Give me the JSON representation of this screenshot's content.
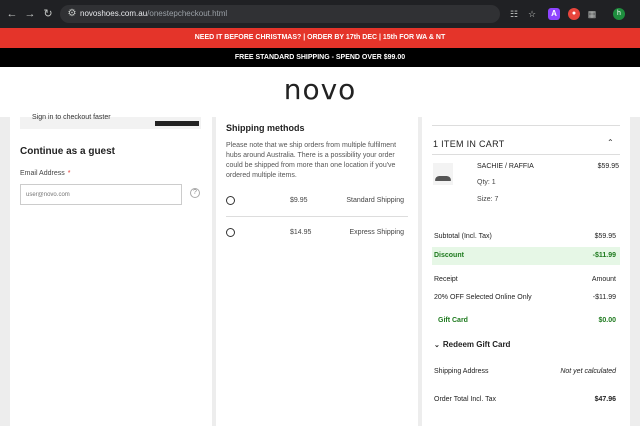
{
  "browser": {
    "url_host": "novoshoes.com.au",
    "url_path": "/onestepcheckout.html",
    "extension_a": "A",
    "profile_initial": "h"
  },
  "banners": {
    "promo": "NEED IT BEFORE CHRISTMAS? | ORDER BY 17th DEC | 15th FOR WA & NT",
    "shipping": "FREE STANDARD SHIPPING - SPEND OVER $99.00"
  },
  "header": {
    "logo": "novo"
  },
  "left": {
    "signin_text": "Sign in to checkout faster",
    "guest_title": "Continue as a guest",
    "email_label": "Email Address",
    "email_required": "*",
    "email_placeholder": "user@novo.com",
    "help_glyph": "?"
  },
  "shipping": {
    "title": "Shipping methods",
    "note": "Please note that we ship orders from multiple fulfilment hubs around Australia. There is a possibility your order could be shipped from more than one location if you've ordered multiple items.",
    "options": [
      {
        "price": "$9.95",
        "name": "Standard Shipping"
      },
      {
        "price": "$14.95",
        "name": "Express Shipping"
      }
    ]
  },
  "cart": {
    "title": "1 ITEM IN CART",
    "item": {
      "name": "SACHIE / RAFFIA",
      "price": "$59.95",
      "qty": "Qty: 1",
      "size": "Size: 7"
    },
    "subtotal_label": "Subtotal (Incl. Tax)",
    "subtotal_value": "$59.95",
    "discount_label": "Discount",
    "discount_value": "-$11.99",
    "receipt_label": "Receipt",
    "amount_label": "Amount",
    "promo_label": "20% OFF Selected Online Only",
    "promo_value": "-$11.99",
    "giftcard_label": "Gift Card",
    "giftcard_value": "$0.00",
    "redeem_label": "Redeem Gift Card",
    "shipping_addr_label": "Shipping Address",
    "shipping_addr_value": "Not yet calculated",
    "total_label": "Order Total Incl. Tax",
    "total_value": "$47.96"
  },
  "colors": {
    "promo_banner": "#e4342a",
    "discount_green": "#1e7a1e",
    "discount_bg": "#e6f7e6"
  }
}
